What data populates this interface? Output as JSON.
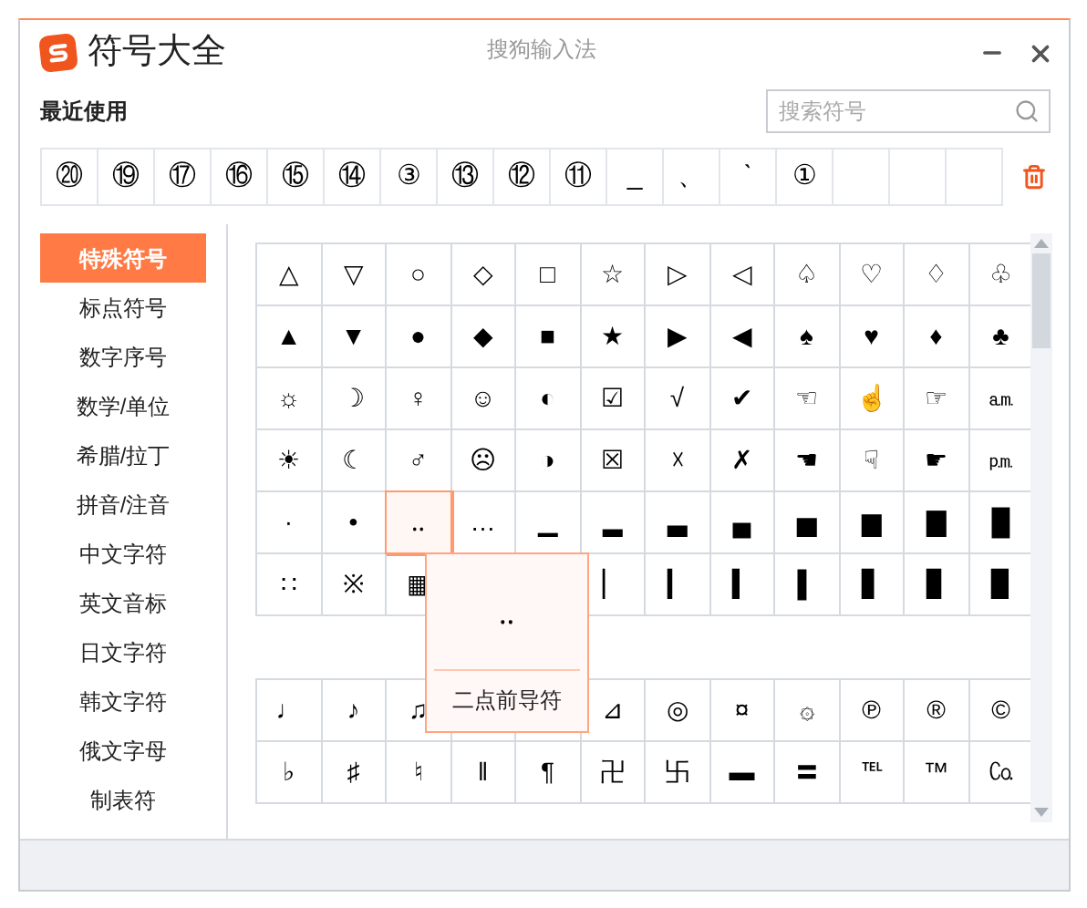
{
  "window": {
    "title": "符号大全",
    "app_name": "搜狗输入法"
  },
  "recent": {
    "label": "最近使用",
    "symbols": [
      "⑳",
      "⑲",
      "⑰",
      "⑯",
      "⑮",
      "⑭",
      "③",
      "⑬",
      "⑫",
      "⑪",
      "_",
      "、",
      "ˋ",
      "①"
    ]
  },
  "search": {
    "placeholder": "搜索符号"
  },
  "sidebar": {
    "items": [
      {
        "label": "特殊符号",
        "selected": true
      },
      {
        "label": "标点符号",
        "selected": false
      },
      {
        "label": "数字序号",
        "selected": false
      },
      {
        "label": "数学/单位",
        "selected": false
      },
      {
        "label": "希腊/拉丁",
        "selected": false
      },
      {
        "label": "拼音/注音",
        "selected": false
      },
      {
        "label": "中文字符",
        "selected": false
      },
      {
        "label": "英文音标",
        "selected": false
      },
      {
        "label": "日文字符",
        "selected": false
      },
      {
        "label": "韩文字符",
        "selected": false
      },
      {
        "label": "俄文字母",
        "selected": false
      },
      {
        "label": "制表符",
        "selected": false
      }
    ]
  },
  "grids": [
    {
      "rows": [
        [
          {
            "symbol": "△",
            "selected": false
          },
          {
            "symbol": "▽",
            "selected": false
          },
          {
            "symbol": "○",
            "selected": false
          },
          {
            "symbol": "◇",
            "selected": false
          },
          {
            "symbol": "□",
            "selected": false
          },
          {
            "symbol": "☆",
            "selected": false
          },
          {
            "symbol": "▷",
            "selected": false
          },
          {
            "symbol": "◁",
            "selected": false
          },
          {
            "symbol": "♤",
            "selected": false
          },
          {
            "symbol": "♡",
            "selected": false
          },
          {
            "symbol": "♢",
            "selected": false
          },
          {
            "symbol": "♧",
            "selected": false
          }
        ],
        [
          {
            "symbol": "▲",
            "selected": false
          },
          {
            "symbol": "▼",
            "selected": false
          },
          {
            "symbol": "●",
            "selected": false
          },
          {
            "symbol": "◆",
            "selected": false
          },
          {
            "symbol": "■",
            "selected": false
          },
          {
            "symbol": "★",
            "selected": false
          },
          {
            "symbol": "▶",
            "selected": false
          },
          {
            "symbol": "◀",
            "selected": false
          },
          {
            "symbol": "♠",
            "selected": false
          },
          {
            "symbol": "♥",
            "selected": false
          },
          {
            "symbol": "♦",
            "selected": false
          },
          {
            "symbol": "♣",
            "selected": false
          }
        ],
        [
          {
            "symbol": "☼",
            "selected": false
          },
          {
            "symbol": "☽",
            "selected": false
          },
          {
            "symbol": "♀",
            "selected": false
          },
          {
            "symbol": "☺",
            "selected": false
          },
          {
            "symbol": "◐",
            "selected": false
          },
          {
            "symbol": "☑",
            "selected": false
          },
          {
            "symbol": "√",
            "selected": false
          },
          {
            "symbol": "✔",
            "selected": false
          },
          {
            "symbol": "☜",
            "selected": false
          },
          {
            "symbol": "☝",
            "selected": false
          },
          {
            "symbol": "☞",
            "selected": false
          },
          {
            "symbol": "㏂",
            "selected": false
          }
        ],
        [
          {
            "symbol": "☀",
            "selected": false
          },
          {
            "symbol": "☾",
            "selected": false
          },
          {
            "symbol": "♂",
            "selected": false
          },
          {
            "symbol": "☹",
            "selected": false
          },
          {
            "symbol": "◑",
            "selected": false
          },
          {
            "symbol": "☒",
            "selected": false
          },
          {
            "symbol": "☓",
            "selected": false
          },
          {
            "symbol": "✗",
            "selected": false
          },
          {
            "symbol": "☚",
            "selected": false
          },
          {
            "symbol": "☟",
            "selected": false
          },
          {
            "symbol": "☛",
            "selected": false
          },
          {
            "symbol": "㏘",
            "selected": false
          }
        ],
        [
          {
            "symbol": "·",
            "selected": false
          },
          {
            "symbol": "•",
            "selected": false
          },
          {
            "symbol": "‥",
            "selected": true
          },
          {
            "symbol": "…",
            "selected": false
          },
          {
            "symbol": "▁",
            "selected": false
          },
          {
            "symbol": "▂",
            "selected": false
          },
          {
            "symbol": "▃",
            "selected": false
          },
          {
            "symbol": "▄",
            "selected": false
          },
          {
            "symbol": "▅",
            "selected": false
          },
          {
            "symbol": "▆",
            "selected": false
          },
          {
            "symbol": "▇",
            "selected": false
          },
          {
            "symbol": "█",
            "selected": false
          }
        ],
        [
          {
            "symbol": "∷",
            "selected": false
          },
          {
            "symbol": "※",
            "selected": false
          },
          {
            "symbol": "▦",
            "selected": false
          },
          null,
          null,
          {
            "symbol": "▏",
            "selected": false
          },
          {
            "symbol": "▎",
            "selected": false
          },
          {
            "symbol": "▍",
            "selected": false
          },
          {
            "symbol": "▌",
            "selected": false
          },
          {
            "symbol": "▋",
            "selected": false
          },
          {
            "symbol": "▊",
            "selected": false
          },
          {
            "symbol": "▉",
            "selected": false
          }
        ]
      ]
    },
    {
      "rows": [
        [
          {
            "symbol": "♩",
            "selected": false
          },
          {
            "symbol": "♪",
            "selected": false
          },
          {
            "symbol": "♫",
            "selected": false
          },
          null,
          null,
          {
            "symbol": "⊿",
            "selected": false
          },
          {
            "symbol": "◎",
            "selected": false
          },
          {
            "symbol": "¤",
            "selected": false
          },
          {
            "symbol": "۞",
            "selected": false
          },
          {
            "symbol": "℗",
            "selected": false
          },
          {
            "symbol": "®",
            "selected": false
          },
          {
            "symbol": "©",
            "selected": false
          }
        ],
        [
          {
            "symbol": "♭",
            "selected": false
          },
          {
            "symbol": "♯",
            "selected": false
          },
          {
            "symbol": "♮",
            "selected": false
          },
          {
            "symbol": "‖",
            "selected": false
          },
          {
            "symbol": "¶",
            "selected": false
          },
          {
            "symbol": "卍",
            "selected": false
          },
          {
            "symbol": "卐",
            "selected": false
          },
          {
            "symbol": "▬",
            "selected": false
          },
          {
            "symbol": "〓",
            "selected": false
          },
          {
            "symbol": "℡",
            "selected": false
          },
          {
            "symbol": "™",
            "selected": false
          },
          {
            "symbol": "㏇",
            "selected": false
          }
        ]
      ]
    }
  ],
  "tooltip": {
    "symbol": "‥",
    "name": "二点前导符"
  }
}
